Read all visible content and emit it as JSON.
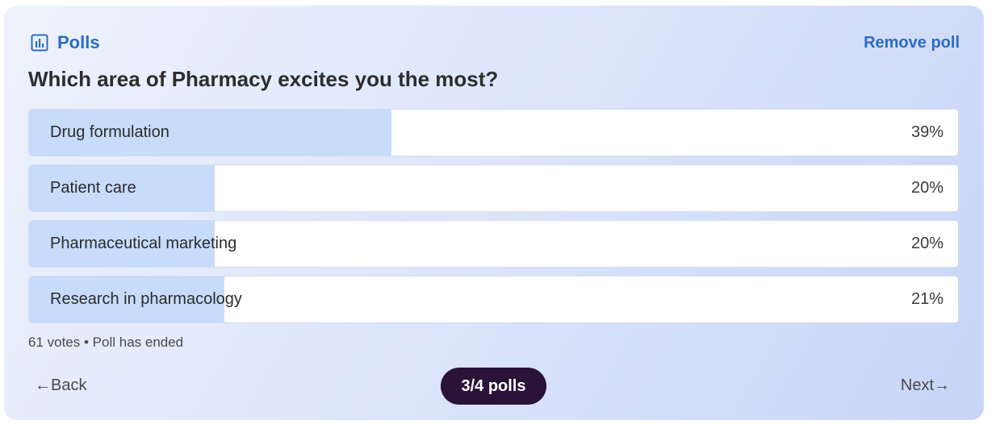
{
  "header": {
    "title": "Polls",
    "icon": "bar-chart-icon",
    "remove_label": "Remove poll",
    "accent_color": "#2b6cc4"
  },
  "poll": {
    "question": "Which area of Pharmacy excites you the most?",
    "options": [
      {
        "label": "Drug formulation",
        "percent_label": "39%",
        "share": 0.39
      },
      {
        "label": "Patient care",
        "percent_label": "20%",
        "share": 0.2
      },
      {
        "label": "Pharmaceutical marketing",
        "percent_label": "20%",
        "share": 0.2
      },
      {
        "label": "Research in pharmacology",
        "percent_label": "21%",
        "share": 0.21
      }
    ],
    "meta": "61 votes • Poll has ended",
    "fill_color": "#c7dcfb"
  },
  "footer": {
    "back_label": "←Back",
    "next_label": "Next→",
    "counter_label": "3/4 polls",
    "counter_color": "#2a1238"
  }
}
